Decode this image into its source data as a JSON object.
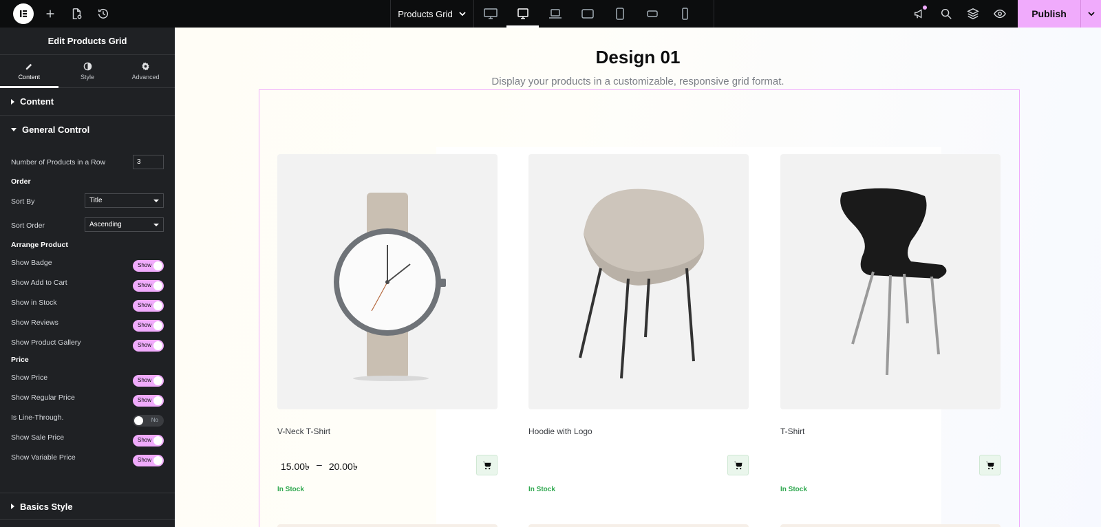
{
  "topbar": {
    "document_title": "Products Grid",
    "publish_label": "Publish"
  },
  "sidebar": {
    "panel_title": "Edit Products Grid",
    "tabs": [
      {
        "label": "Content",
        "icon": "pencil-icon"
      },
      {
        "label": "Style",
        "icon": "half-circle-icon"
      },
      {
        "label": "Advanced",
        "icon": "gear-icon"
      }
    ],
    "sections": {
      "content": "Content",
      "general_control": "General Control",
      "basics_style": "Basics Style"
    },
    "controls": {
      "products_in_row_label": "Number of Products in a Row",
      "products_in_row_value": "3",
      "order_heading": "Order",
      "sort_by_label": "Sort By",
      "sort_by_value": "Title",
      "sort_order_label": "Sort Order",
      "sort_order_value": "Ascending",
      "arrange_heading": "Arrange Product",
      "price_heading": "Price"
    },
    "toggles": [
      {
        "label": "Show Badge",
        "state": "Show"
      },
      {
        "label": "Show Add to Cart",
        "state": "Show"
      },
      {
        "label": "Show in Stock",
        "state": "Show"
      },
      {
        "label": "Show Reviews",
        "state": "Show"
      },
      {
        "label": "Show Product Gallery",
        "state": "Show"
      },
      {
        "label": "Show Price",
        "state": "Show"
      },
      {
        "label": "Show Regular Price",
        "state": "Show"
      },
      {
        "label": "Is Line-Through.",
        "state": "No"
      },
      {
        "label": "Show Sale Price",
        "state": "Show"
      },
      {
        "label": "Show Variable Price",
        "state": "Show"
      }
    ]
  },
  "canvas": {
    "heading": "Design 01",
    "subheading": "Display your products in a customizable, responsive grid format.",
    "products": [
      {
        "name": "V-Neck T-Shirt",
        "price_min": "15.00৳",
        "price_sep": "–",
        "price_max": "20.00৳",
        "stock": "In Stock",
        "image": "watch"
      },
      {
        "name": "Hoodie with Logo",
        "stock": "In Stock",
        "image": "lounge-chair"
      },
      {
        "name": "T-Shirt",
        "stock": "In Stock",
        "image": "black-chair"
      }
    ]
  },
  "colors": {
    "accent": "#f0abfc",
    "topbar_bg": "#0c0d0e",
    "panel_bg": "#1f2124",
    "in_stock": "#2fa84f"
  }
}
